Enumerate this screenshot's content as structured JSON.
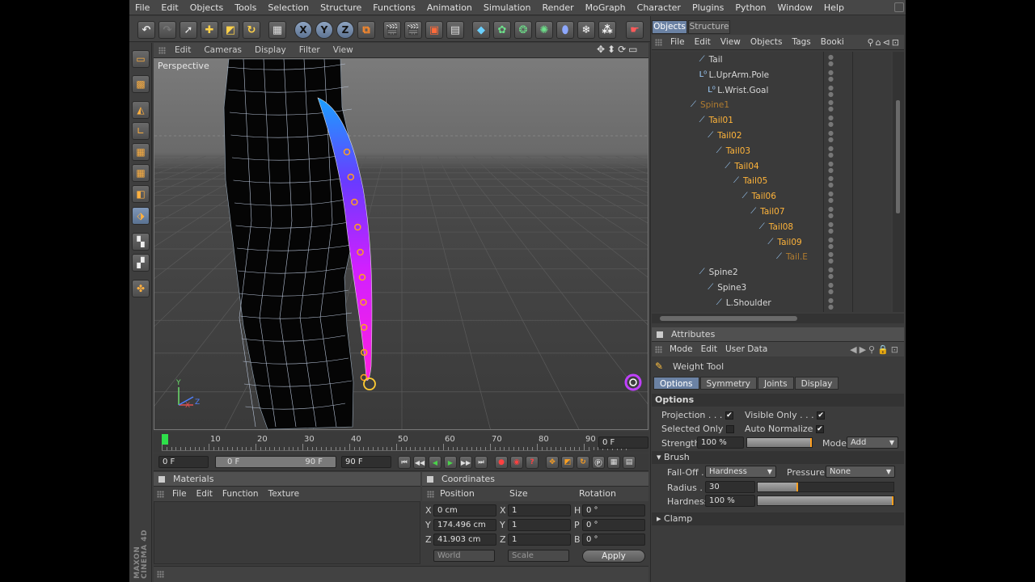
{
  "menu": [
    "File",
    "Edit",
    "Objects",
    "Tools",
    "Selection",
    "Structure",
    "Functions",
    "Animation",
    "Simulation",
    "Render",
    "MoGraph",
    "Character",
    "Plugins",
    "Python",
    "Window",
    "Help"
  ],
  "viewport": {
    "menu": [
      "Edit",
      "Cameras",
      "Display",
      "Filter",
      "View"
    ],
    "label": "Perspective",
    "axis": {
      "y": "Y",
      "x": "X",
      "z": "Z"
    }
  },
  "obj_manager": {
    "tabs": [
      "Objects",
      "Structure"
    ],
    "menu": [
      "File",
      "Edit",
      "View",
      "Objects",
      "Tags",
      "Booki"
    ],
    "rows": [
      {
        "name": "Tail",
        "color": "#d8d8d8",
        "indent": 1
      },
      {
        "name": "L.UprArm.Pole",
        "color": "#d8d8d8",
        "indent": 1
      },
      {
        "name": "L.Wrist.Goal",
        "color": "#d8d8d8",
        "indent": 2
      },
      {
        "name": "Spine1",
        "color": "#b07c30",
        "indent": 0
      },
      {
        "name": "Tail01",
        "color": "#ffb43a",
        "indent": 1
      },
      {
        "name": "Tail02",
        "color": "#ffb43a",
        "indent": 2
      },
      {
        "name": "Tail03",
        "color": "#ffb43a",
        "indent": 3
      },
      {
        "name": "Tail04",
        "color": "#ffb43a",
        "indent": 4
      },
      {
        "name": "Tail05",
        "color": "#ffb43a",
        "indent": 5
      },
      {
        "name": "Tail06",
        "color": "#ffb43a",
        "indent": 6
      },
      {
        "name": "Tail07",
        "color": "#ffb43a",
        "indent": 7
      },
      {
        "name": "Tail08",
        "color": "#ffb43a",
        "indent": 8
      },
      {
        "name": "Tail09",
        "color": "#ffb43a",
        "indent": 9
      },
      {
        "name": "Tail.E",
        "color": "#b07c30",
        "indent": 10
      },
      {
        "name": "Spine2",
        "color": "#d8d8d8",
        "indent": 1
      },
      {
        "name": "Spine3",
        "color": "#d8d8d8",
        "indent": 2
      },
      {
        "name": "L.Shoulder",
        "color": "#d8d8d8",
        "indent": 3
      }
    ]
  },
  "attributes": {
    "title": "Attributes",
    "menu": [
      "Mode",
      "Edit",
      "User Data"
    ],
    "tool": "Weight Tool",
    "tabs": [
      "Options",
      "Symmetry",
      "Joints",
      "Display"
    ],
    "section": "Options",
    "projection": "Projection . . .",
    "visible_only": "Visible Only . . .",
    "selected_only": "Selected Only",
    "auto_normalize": "Auto Normalize",
    "strength_label": "Strength",
    "strength": "100 %",
    "strength_level": 1.0,
    "mode_label": "Mode",
    "mode": "Add",
    "brush": "Brush",
    "falloff_label": "Fall-Off . .",
    "falloff": "Hardness",
    "pressure_label": "Pressure",
    "pressure": "None",
    "radius_label": "Radius . .",
    "radius": "30",
    "radius_level": 0.3,
    "hardness_label": "Hardness",
    "hardness": "100 %",
    "hardness_level": 1.0,
    "clamp": "Clamp"
  },
  "timeline": {
    "ticks": [
      "0",
      "10",
      "20",
      "30",
      "40",
      "50",
      "60",
      "70",
      "80",
      "90"
    ],
    "current_frame": "0 F",
    "start": "0 F",
    "range_start": "0 F",
    "range_end": "90 F",
    "end": "90 F"
  },
  "materials": {
    "title": "Materials",
    "menu": [
      "File",
      "Edit",
      "Function",
      "Texture"
    ]
  },
  "coordinates": {
    "title": "Coordinates",
    "headers": [
      "Position",
      "Size",
      "Rotation"
    ],
    "rows": [
      {
        "axis": "X",
        "pos": "0 cm",
        "saxis": "X",
        "size": "1",
        "raxis": "H",
        "rot": "0 °"
      },
      {
        "axis": "Y",
        "pos": "174.496 cm",
        "saxis": "Y",
        "size": "1",
        "raxis": "P",
        "rot": "0 °"
      },
      {
        "axis": "Z",
        "pos": "41.903 cm",
        "saxis": "Z",
        "size": "1",
        "raxis": "B",
        "rot": "0 °"
      }
    ],
    "world": "World",
    "scale": "Scale",
    "apply": "Apply"
  },
  "brand": "MAXON CINEMA 4D"
}
